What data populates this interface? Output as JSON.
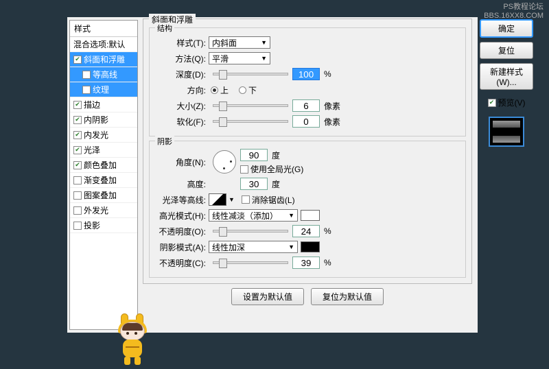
{
  "watermark": {
    "l1": "PS教程论坛",
    "l2": "BBS.16XX8.COM"
  },
  "left": {
    "header": "样式",
    "blend": "混合选项:默认",
    "items": [
      {
        "label": "斜面和浮雕",
        "checked": true,
        "selected": true
      },
      {
        "label": "等高线",
        "checked": false,
        "sub": true,
        "selected": true
      },
      {
        "label": "纹理",
        "checked": false,
        "sub": true,
        "selected": true
      },
      {
        "label": "描边",
        "checked": true
      },
      {
        "label": "内阴影",
        "checked": true
      },
      {
        "label": "内发光",
        "checked": true
      },
      {
        "label": "光泽",
        "checked": true
      },
      {
        "label": "颜色叠加",
        "checked": true
      },
      {
        "label": "渐变叠加",
        "checked": false
      },
      {
        "label": "图案叠加",
        "checked": false
      },
      {
        "label": "外发光",
        "checked": false
      },
      {
        "label": "投影",
        "checked": false
      }
    ]
  },
  "main": {
    "title": "斜面和浮雕",
    "structure": {
      "title": "结构",
      "style_label": "样式(T):",
      "style_value": "内斜面",
      "method_label": "方法(Q):",
      "method_value": "平滑",
      "depth_label": "深度(D):",
      "depth_value": "100",
      "depth_unit": "%",
      "direction_label": "方向:",
      "up": "上",
      "down": "下",
      "size_label": "大小(Z):",
      "size_value": "6",
      "size_unit": "像素",
      "soften_label": "软化(F):",
      "soften_value": "0",
      "soften_unit": "像素"
    },
    "shadow": {
      "title": "阴影",
      "angle_label": "角度(N):",
      "angle_value": "90",
      "angle_unit": "度",
      "global_label": "使用全局光(G)",
      "altitude_label": "高度:",
      "altitude_value": "30",
      "altitude_unit": "度",
      "gloss_label": "光泽等高线:",
      "anti_label": "消除锯齿(L)",
      "hmode_label": "高光模式(H):",
      "hmode_value": "线性减淡（添加）",
      "hopacity_label": "不透明度(O):",
      "hopacity_value": "24",
      "hopacity_unit": "%",
      "smode_label": "阴影模式(A):",
      "smode_value": "线性加深",
      "sopacity_label": "不透明度(C):",
      "sopacity_value": "39",
      "sopacity_unit": "%"
    },
    "btn_default": "设置为默认值",
    "btn_reset": "复位为默认值"
  },
  "right": {
    "ok": "确定",
    "cancel": "复位",
    "newstyle": "新建样式(W)...",
    "preview": "预览(V)"
  }
}
